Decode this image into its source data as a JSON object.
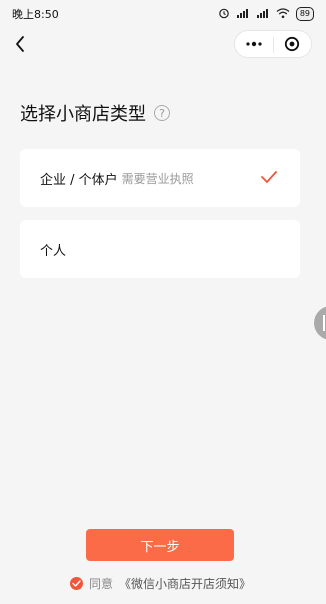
{
  "status_bar": {
    "time": "晚上8:50",
    "battery": "89"
  },
  "page": {
    "title": "选择小商店类型",
    "help_glyph": "?"
  },
  "options": [
    {
      "label": "企业 / 个体户",
      "sub": "需要营业执照",
      "selected": true
    },
    {
      "label": "个人",
      "sub": "",
      "selected": false
    }
  ],
  "next_button": "下一步",
  "agreement": {
    "prefix": "同意",
    "link": "《微信小商店开店须知》"
  },
  "colors": {
    "accent": "#fb6b48",
    "check": "#f0563a",
    "background": "#f5f5f5"
  },
  "icons": [
    "back-icon",
    "more-icon",
    "target-icon",
    "help-icon",
    "checkmark-icon"
  ]
}
